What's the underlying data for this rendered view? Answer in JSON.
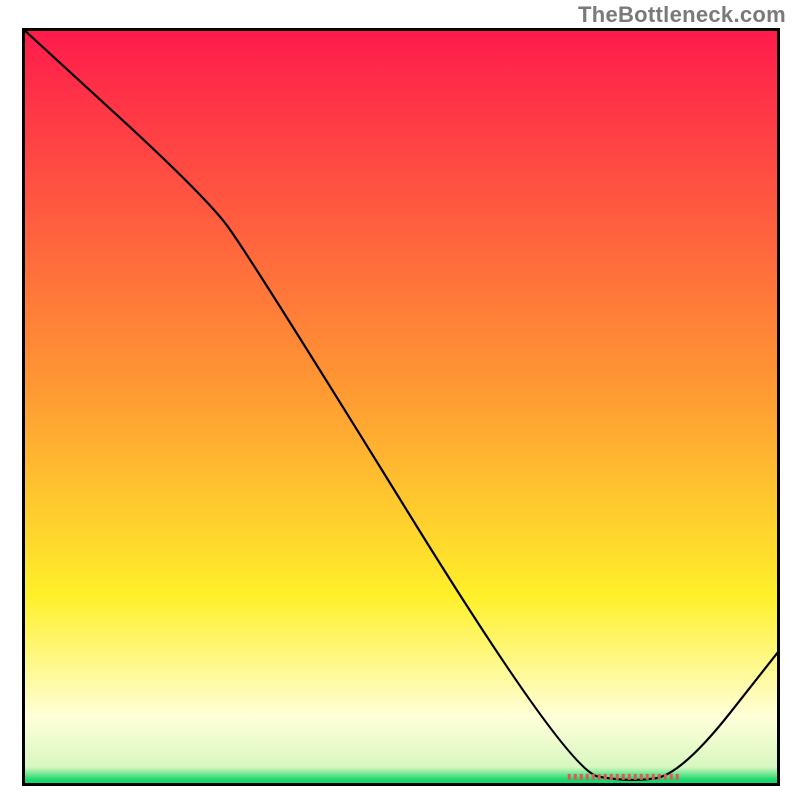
{
  "attribution": "TheBottleneck.com",
  "chart_data": {
    "type": "line",
    "title": "",
    "xlabel": "",
    "ylabel": "",
    "xlim": [
      0,
      100
    ],
    "ylim": [
      0,
      100
    ],
    "grid": false,
    "legend": false,
    "gradient_top": "#ff1a4c",
    "gradient_mid_orange": "#ff9a33",
    "gradient_yellow": "#fff02a",
    "gradient_pale_yellow": "#ffffd9",
    "gradient_green": "#18d86a",
    "annotation": {
      "label": "",
      "color": "#e05a5a",
      "x_start": 72,
      "x_end": 87,
      "y": 1.2
    },
    "series": [
      {
        "name": "bottleneck-curve",
        "color": "#000000",
        "width": 2.2,
        "points": [
          {
            "x": 0,
            "y": 100
          },
          {
            "x": 24,
            "y": 78
          },
          {
            "x": 30,
            "y": 70
          },
          {
            "x": 72,
            "y": 2
          },
          {
            "x": 80,
            "y": 0.5
          },
          {
            "x": 87,
            "y": 1.5
          },
          {
            "x": 100,
            "y": 18
          }
        ]
      }
    ]
  }
}
